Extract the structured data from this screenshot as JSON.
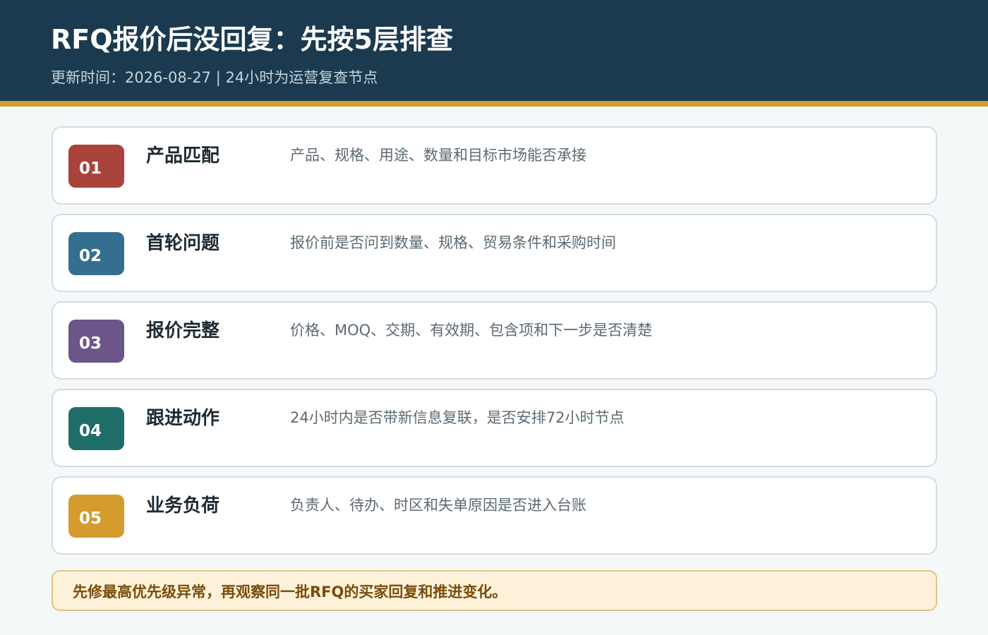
{
  "header": {
    "title": "RFQ报价后没回复：先按5层排查",
    "subtitle": "更新时间：2026-08-27 | 24小时为运营复查节点"
  },
  "accent_colors": {
    "header_bg": "#1b3a4f",
    "header_rule": "#d49b2f"
  },
  "layers": [
    {
      "number": "01",
      "title": "产品匹配",
      "description": "产品、规格、用途、数量和目标市场能否承接",
      "color": "#a9433b"
    },
    {
      "number": "02",
      "title": "首轮问题",
      "description": "报价前是否问到数量、规格、贸易条件和采购时间",
      "color": "#356f8f"
    },
    {
      "number": "03",
      "title": "报价完整",
      "description": "价格、MOQ、交期、有效期、包含项和下一步是否清楚",
      "color": "#6b5589"
    },
    {
      "number": "04",
      "title": "跟进动作",
      "description": "24小时内是否带新信息复联，是否安排72小时节点",
      "color": "#1f6d68"
    },
    {
      "number": "05",
      "title": "业务负荷",
      "description": "负责人、待办、时区和失单原因是否进入台账",
      "color": "#d49b2f"
    }
  ],
  "footer_note": "先修最高优先级异常，再观察同一批RFQ的买家回复和推进变化。"
}
